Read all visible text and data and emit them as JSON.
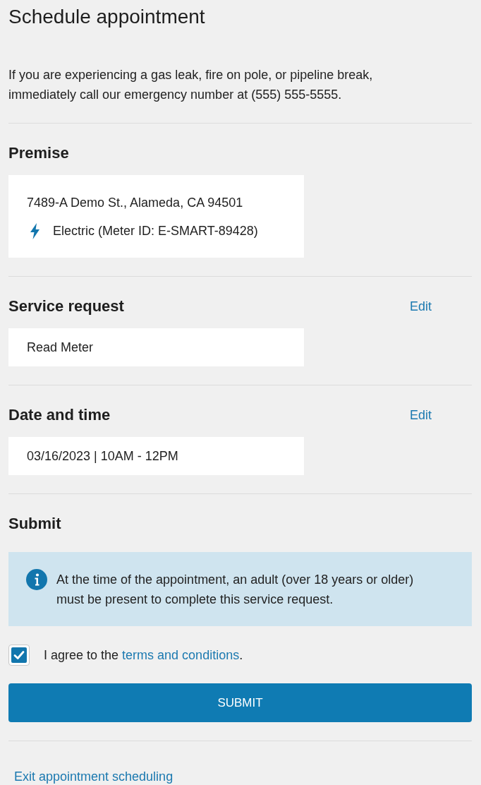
{
  "page_title": "Schedule appointment",
  "emergency_notice": "If you are experiencing a gas leak, fire on pole, or pipeline break, immediately call our emergency number at (555) 555-5555.",
  "sections": [
    {
      "kind": "premise",
      "heading": "Premise",
      "address": "7489-A Demo St., Alameda, CA 94501",
      "service": {
        "kind": "electric",
        "label": "Electric (Meter ID: E-SMART-89428)"
      }
    },
    {
      "kind": "summary",
      "heading": "Service request",
      "edit": "Edit",
      "value": "Read Meter"
    },
    {
      "kind": "summary",
      "heading": "Date and time",
      "edit": "Edit",
      "value": "03/16/2023 | 10AM - 12PM"
    }
  ],
  "submit": {
    "heading": "Submit",
    "notice": "At the time of the appointment, an adult (over 18 years or older) must be present to complete this service request.",
    "agreement": {
      "checked": true,
      "text": "I agree to the",
      "link": "terms and conditions",
      "suffix": "."
    },
    "button": "SUBMIT"
  },
  "exit_link": "Exit appointment scheduling"
}
